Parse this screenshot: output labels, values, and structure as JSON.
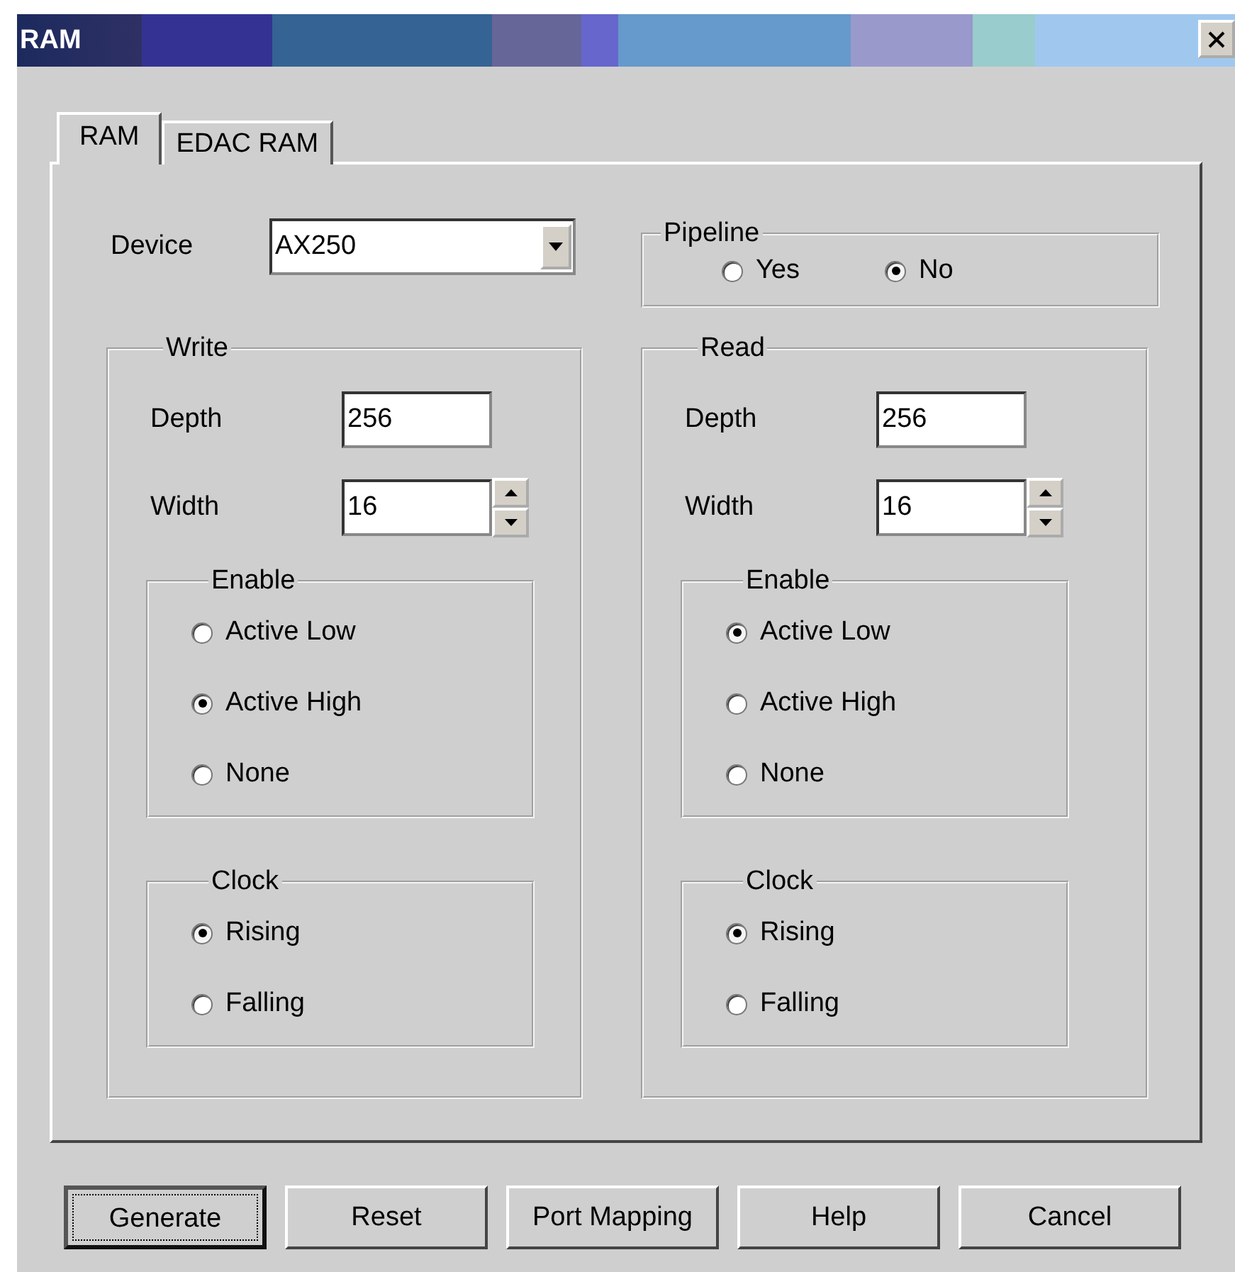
{
  "window": {
    "title": "RAM"
  },
  "tabs": [
    {
      "label": "RAM",
      "selected": true
    },
    {
      "label": "EDAC RAM",
      "selected": false
    }
  ],
  "device": {
    "label": "Device",
    "value": "AX250"
  },
  "pipeline": {
    "title": "Pipeline",
    "options": [
      {
        "label": "Yes",
        "selected": false
      },
      {
        "label": "No",
        "selected": true
      }
    ]
  },
  "ports": [
    {
      "title": "Write",
      "depth": {
        "label": "Depth",
        "value": "256"
      },
      "width": {
        "label": "Width",
        "value": "16"
      },
      "enable": {
        "title": "Enable",
        "options": [
          {
            "label": "Active Low",
            "selected": false
          },
          {
            "label": "Active High",
            "selected": true
          },
          {
            "label": "None",
            "selected": false
          }
        ]
      },
      "clock": {
        "title": "Clock",
        "options": [
          {
            "label": "Rising",
            "selected": true
          },
          {
            "label": "Falling",
            "selected": false
          }
        ]
      }
    },
    {
      "title": "Read",
      "depth": {
        "label": "Depth",
        "value": "256"
      },
      "width": {
        "label": "Width",
        "value": "16"
      },
      "enable": {
        "title": "Enable",
        "options": [
          {
            "label": "Active Low",
            "selected": true
          },
          {
            "label": "Active High",
            "selected": false
          },
          {
            "label": "None",
            "selected": false
          }
        ]
      },
      "clock": {
        "title": "Clock",
        "options": [
          {
            "label": "Rising",
            "selected": true
          },
          {
            "label": "Falling",
            "selected": false
          }
        ]
      }
    }
  ],
  "buttons": [
    {
      "label": "Generate",
      "focused": true
    },
    {
      "label": "Reset",
      "focused": false
    },
    {
      "label": "Port Mapping",
      "focused": false
    },
    {
      "label": "Help",
      "focused": false
    },
    {
      "label": "Cancel",
      "focused": false
    }
  ]
}
